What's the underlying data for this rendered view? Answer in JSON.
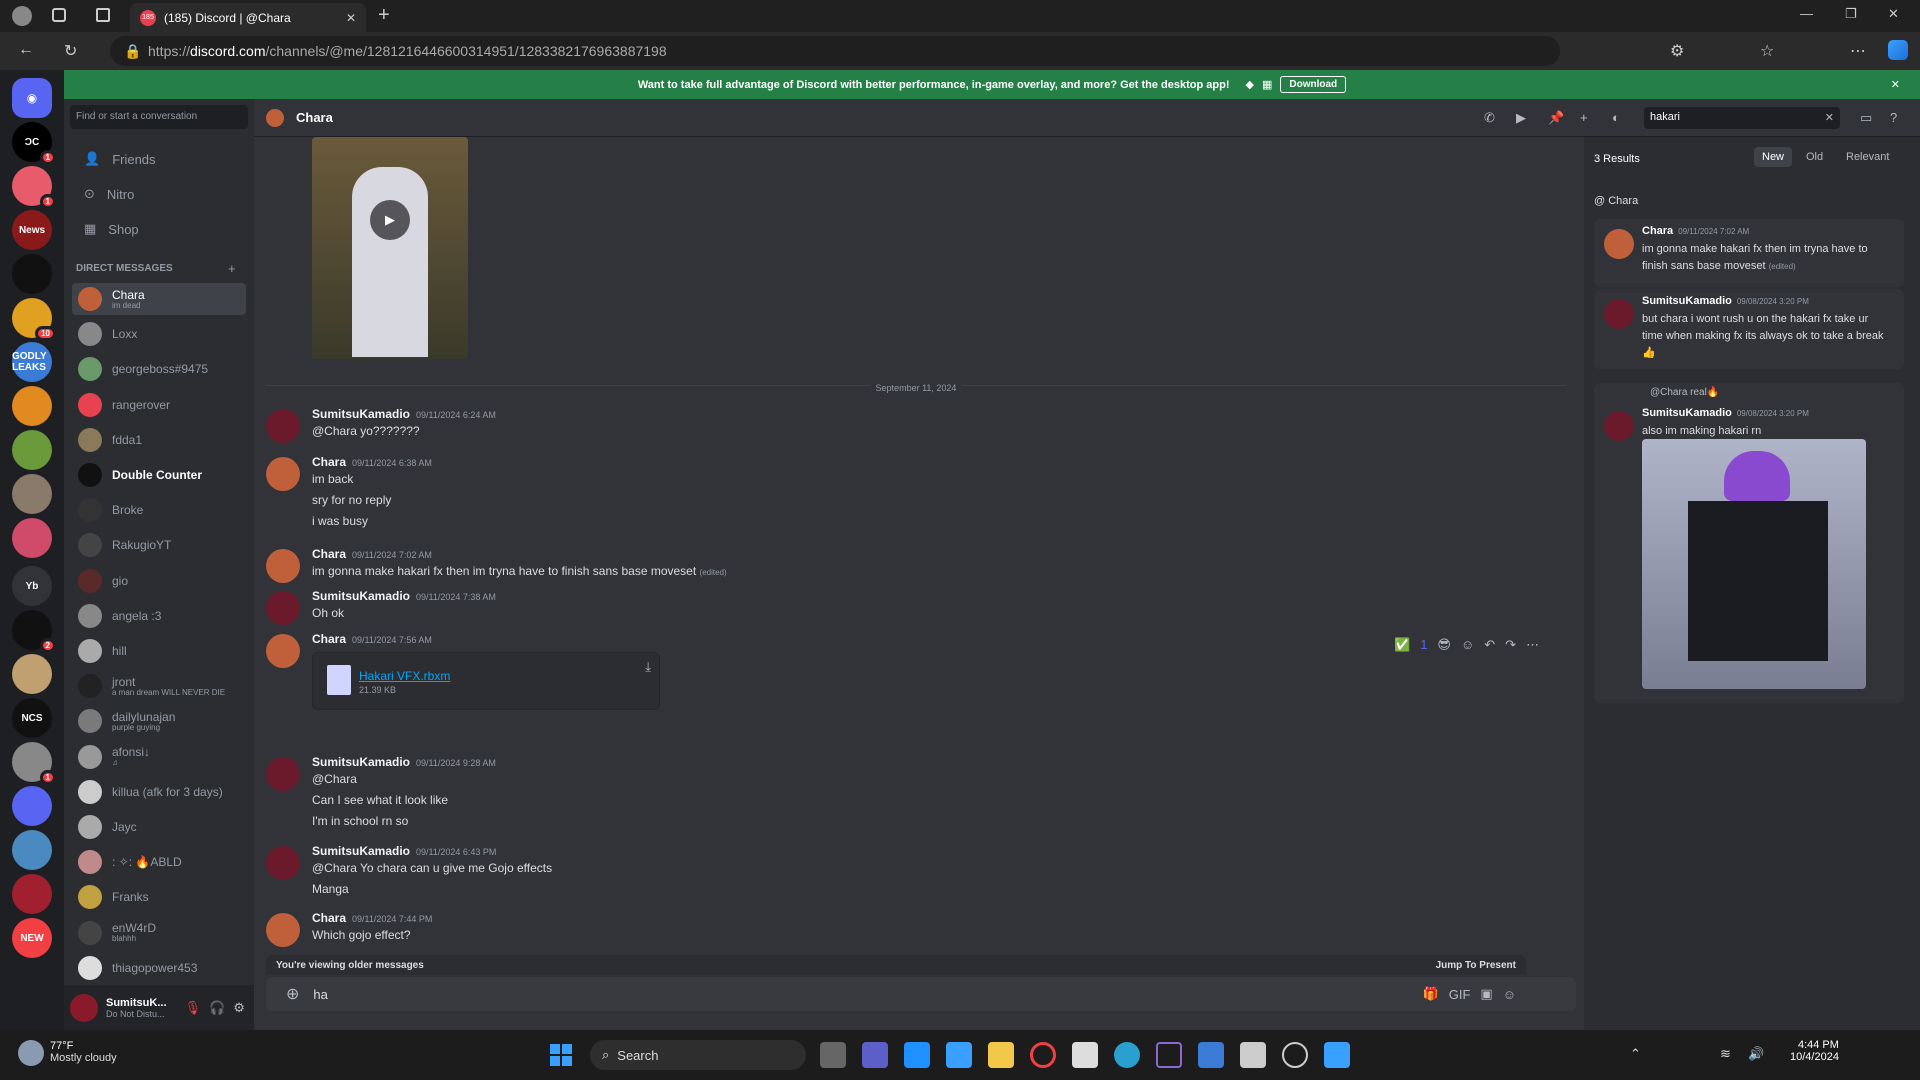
{
  "browser": {
    "tab_title": "(185) Discord | @Chara",
    "tab_badge": "185",
    "url_prefix": "https://",
    "url_domain": "discord.com",
    "url_path": "/channels/@me/1281216446600314951/1283382176963887198"
  },
  "banner": {
    "text": "Want to take full advantage of Discord with better performance, in-game overlay, and more? Get the desktop app!",
    "download_label": "Download"
  },
  "guilds": [
    {
      "label": "ϽC",
      "badge": "1",
      "color": "#000000"
    },
    {
      "label": "",
      "badge": "1",
      "color": "#e85b6b"
    },
    {
      "label": "News",
      "badge": "",
      "color": "#8a1a1a"
    },
    {
      "label": "",
      "badge": "",
      "color": "#111111"
    },
    {
      "label": "",
      "badge": "10",
      "color": "#e0a020"
    },
    {
      "label": "GODLY LEAKS",
      "badge": "",
      "color": "#3a7bd5"
    },
    {
      "label": "",
      "badge": "",
      "color": "#e08a20"
    },
    {
      "label": "",
      "badge": "",
      "color": "#6a9a3a"
    },
    {
      "label": "",
      "badge": "",
      "color": "#8a7a6a"
    },
    {
      "label": "",
      "badge": "",
      "color": "#d04a6a"
    },
    {
      "label": "Yb",
      "badge": "",
      "color": "#313338"
    },
    {
      "label": "",
      "badge": "2",
      "color": "#111111"
    },
    {
      "label": "",
      "badge": "",
      "color": "#c0a070"
    },
    {
      "label": "NCS",
      "badge": "",
      "color": "#111111"
    },
    {
      "label": "",
      "badge": "1",
      "color": "#888888"
    },
    {
      "label": "",
      "badge": "",
      "color": "#5865f2"
    },
    {
      "label": "",
      "badge": "",
      "color": "#4a8ac0"
    },
    {
      "label": "",
      "badge": "",
      "color": "#a02030"
    },
    {
      "label": "NEW",
      "badge": "",
      "color": "#f23f43"
    }
  ],
  "dm_sidebar": {
    "search_placeholder": "Find or start a conversation",
    "nav": [
      "Friends",
      "Nitro",
      "Shop"
    ],
    "section_title": "DIRECT MESSAGES",
    "add": "+",
    "dms": [
      {
        "name": "Chara",
        "sub": "im dead",
        "color": "#c0603a",
        "selected": true
      },
      {
        "name": "Loxx",
        "sub": "",
        "color": "#888"
      },
      {
        "name": "georgeboss#9475",
        "sub": "",
        "color": "#6a9a6a"
      },
      {
        "name": "rangerover",
        "sub": "",
        "color": "#e8414f"
      },
      {
        "name": "fdda1",
        "sub": "",
        "color": "#8a7a5a"
      },
      {
        "name": "Double Counter",
        "sub": "",
        "color": "#111",
        "bold": true
      },
      {
        "name": "Broke",
        "sub": "",
        "color": "#333"
      },
      {
        "name": "RakugioYT",
        "sub": "",
        "color": "#444"
      },
      {
        "name": "gio",
        "sub": "",
        "color": "#5a2a2a"
      },
      {
        "name": "angela :3",
        "sub": "",
        "color": "#888"
      },
      {
        "name": "hill",
        "sub": "",
        "color": "#aaa"
      },
      {
        "name": "jront",
        "sub": "a man dream WILL NEVER DIE",
        "color": "#222"
      },
      {
        "name": "dailylunajan",
        "sub": "purple guying",
        "color": "#7a7a7a"
      },
      {
        "name": "afonsi↓",
        "sub": "♫",
        "color": "#999"
      },
      {
        "name": "killua (afk for 3 days)",
        "sub": "",
        "color": "#ccc"
      },
      {
        "name": "Jayc",
        "sub": "",
        "color": "#aaa"
      },
      {
        "name": ": ✧: 🔥ABLD",
        "sub": "",
        "color": "#c08a8a"
      },
      {
        "name": "Franks",
        "sub": "",
        "color": "#c0a040"
      },
      {
        "name": "enW4rD",
        "sub": "blahhh",
        "color": "#444"
      },
      {
        "name": "thiagopower453",
        "sub": "",
        "color": "#ddd"
      }
    ]
  },
  "user_panel": {
    "name": "SumitsuK...",
    "status": "Do Not Distu..."
  },
  "chat_header": {
    "name": "Chara"
  },
  "date_divider": "September 11, 2024",
  "messages": [
    {
      "author": "SumitsuKamadio",
      "ts": "09/11/2024 6:24 AM",
      "lines": [
        "@Chara yo???????"
      ]
    },
    {
      "author": "Chara",
      "ts": "09/11/2024 6:38 AM",
      "lines": [
        "im back",
        "sry for no reply",
        "i was busy"
      ]
    },
    {
      "author": "Chara",
      "ts": "09/11/2024 7:02 AM",
      "lines": [
        "im gonna make hakari fx then im tryna have to finish sans base moveset"
      ],
      "edited": "(edited)"
    },
    {
      "author": "SumitsuKamadio",
      "ts": "09/11/2024 7:38 AM",
      "lines": [
        "Oh ok"
      ]
    },
    {
      "author": "Chara",
      "ts": "09/11/2024 7:56 AM",
      "file": {
        "name": "Hakari VFX.rbxm",
        "size": "21.39 KB"
      }
    },
    {
      "author": "SumitsuKamadio",
      "ts": "09/11/2024 9:28 AM",
      "lines": [
        "@Chara",
        "Can I see what it look like",
        "I'm in school rn so"
      ]
    },
    {
      "author": "SumitsuKamadio",
      "ts": "09/11/2024 6:43 PM",
      "lines": [
        "@Chara Yo chara can u give me Gojo effects",
        "Manga"
      ]
    },
    {
      "author": "Chara",
      "ts": "09/11/2024 7:44 PM",
      "lines": [
        "Which gojo effect?"
      ]
    }
  ],
  "older_bar": {
    "text": "You're viewing older messages",
    "jump": "Jump To Present"
  },
  "input": {
    "value": "ha"
  },
  "search": {
    "query": "hakari",
    "count": "3 Results",
    "sort": [
      "New",
      "Old",
      "Relevant"
    ],
    "channel": "@ Chara",
    "results": [
      {
        "author": "Chara",
        "ts": "09/11/2024 7:02 AM",
        "text": "im gonna make hakari fx then im tryna have to finish sans base moveset",
        "edited": "(edited)"
      },
      {
        "author": "SumitsuKamadio",
        "ts": "09/08/2024 3:20 PM",
        "text": "but chara i wont rush u on the hakari fx take ur time when making fx its always ok to take a break 👍"
      },
      {
        "author": "SumitsuKamadio",
        "ts": "09/08/2024 3:20 PM",
        "reply": "@Chara real🔥",
        "text": "also im making hakari rn"
      }
    ]
  },
  "taskbar": {
    "weather_temp": "77°F",
    "weather_desc": "Mostly cloudy",
    "search": "Search",
    "time": "4:44 PM",
    "date": "10/4/2024"
  },
  "colors": {
    "accent": "#5865f2",
    "green": "#248046",
    "bg": "#313338"
  }
}
